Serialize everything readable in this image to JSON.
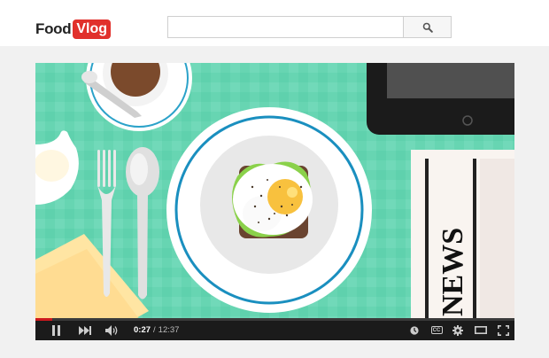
{
  "logo": {
    "part1": "Food",
    "part2": "Vlog"
  },
  "search": {
    "value": "",
    "placeholder": ""
  },
  "video": {
    "newspaper_text": "NEWS",
    "current_time": "0:27",
    "separator": "/",
    "duration": "12:37",
    "progress_fraction": 0.036
  },
  "icons": {
    "search": "search-icon",
    "pause": "pause-icon",
    "next": "next-icon",
    "volume": "volume-icon",
    "watch_later": "clock-icon",
    "captions": "cc-icon",
    "settings": "gear-icon",
    "theater": "theater-icon",
    "fullscreen": "fullscreen-icon"
  },
  "captions_label": "CC",
  "colors": {
    "brand_red": "#e1302b",
    "tablecloth": "#5fd1ad",
    "control_bar": "#1b1b1b",
    "progress": "#cc181e"
  }
}
